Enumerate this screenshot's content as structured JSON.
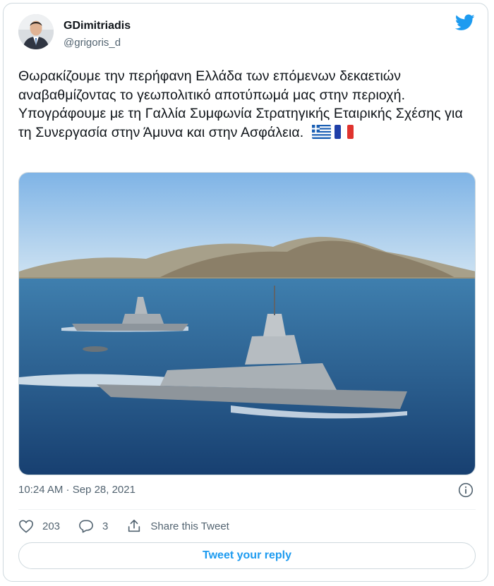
{
  "author": {
    "display_name": "GDimitriadis",
    "handle": "@grigoris_d"
  },
  "tweet": {
    "text": "Θωρακίζουμε την περήφανη Ελλάδα των επόμενων δεκαετιών αναβαθμίζοντας το γεωπολιτικό αποτύπωμά μας στην περιοχή. Υπογράφουμε με τη Γαλλία Συμφωνία Στρατηγικής Εταιρικής Σχέσης για τη Συνεργασία στην Άμυνα και στην Ασφάλεια.",
    "flags": [
      "greece-flag",
      "france-flag"
    ]
  },
  "meta": {
    "timestamp": "10:24 AM · Sep 28, 2021"
  },
  "actions": {
    "likes": "203",
    "replies": "3",
    "share_label": "Share this Tweet"
  },
  "reply_button_label": "Tweet your reply",
  "icons": [
    "twitter-bird-icon",
    "info-icon",
    "heart-icon",
    "reply-bubble-icon",
    "share-icon"
  ],
  "colors": {
    "accent": "#1d9bf0",
    "text": "#0f1419",
    "secondary_text": "#536471",
    "border": "#cfd9de"
  }
}
